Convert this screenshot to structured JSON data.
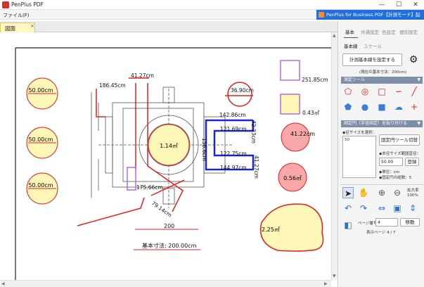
{
  "app": {
    "title": "PenPlus PDF",
    "badge": "PenPlus for Business PDF【計測モード】起動中"
  },
  "menu": {
    "file": "ファイル(F)"
  },
  "tab": {
    "label": "図面",
    "close": "×"
  },
  "window_controls": {
    "min": "—",
    "max": "☐",
    "close": "✕"
  },
  "panel": {
    "tabs": [
      "基本",
      "共通設定",
      "色設定",
      "個別設定"
    ],
    "subtabs": [
      "基本線",
      "スケール"
    ],
    "set_ref_button": "計測基本線を設定する",
    "current_ref": "(現在の基本寸法：200cm)",
    "measure_tools": "測定ツール",
    "fixed_circle": "固定円（半径固定）を貼り付ける",
    "radius_select": "◆径サイズを選択：",
    "radius_value": "50",
    "switch_button": "固定円ツール切替",
    "range_label": "◆本径サイズ範囲直径：",
    "range_value": "50.00",
    "register_button": "登録",
    "unit": "◆単位：cm",
    "count": "◆固定円の総数：5",
    "zoom_label": "拡大率",
    "zoom_value": "100%",
    "page_no_label": "ページ番号",
    "page_value": "4",
    "move_button": "移動",
    "page_total": "表示ページ 4 / 7"
  },
  "drawing": {
    "circles": [
      "50.00cm",
      "50.00cm",
      "50.00cm"
    ],
    "labels": {
      "a1": "186.45cm",
      "a2": "41.27cm",
      "a3": "36.90cm",
      "a4": "251.85cm",
      "a5": "142.86cm",
      "a6": "42.33cm",
      "a7": "121.69cm",
      "a8": "0.43㎡",
      "a9": "41.22cm",
      "a10": "1.14㎡",
      "a11": "156.6cm",
      "a12": "122.75cm",
      "a13": "144.97cm",
      "a14": "41.27cm",
      "a15": "0.56㎡",
      "a16": "175.66cm",
      "a17": "79.14cm",
      "a18": "200",
      "a19": "2.25㎡",
      "a20": "基本寸法: 200.00cm"
    }
  },
  "colors": {
    "accent": "#1e6fe0",
    "measure_red": "#e02020",
    "blue": "#1a28c8",
    "purple": "#b06be0",
    "fill_yellow": "#fff7b8",
    "fill_pink": "#f8a8a8"
  }
}
